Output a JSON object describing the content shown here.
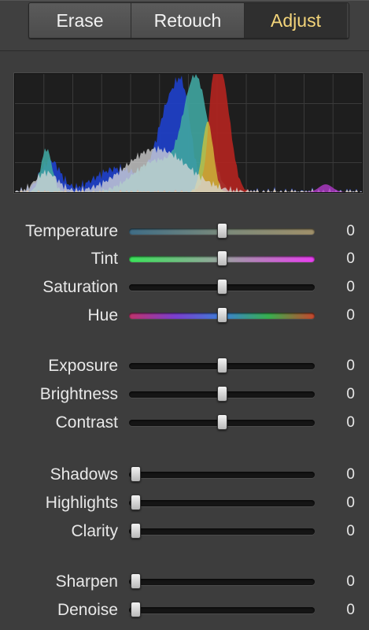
{
  "tabs": [
    {
      "label": "Erase",
      "active": false
    },
    {
      "label": "Retouch",
      "active": false
    },
    {
      "label": "Adjust",
      "active": true
    }
  ],
  "colors": {
    "active_tab_text": "#f4d57a",
    "background": "#3d3d3d",
    "histogram_bg": "#1e1e1e"
  },
  "sliders": [
    {
      "id": "temperature",
      "label": "Temperature",
      "value": "0",
      "position": 0.5,
      "track": "temperature"
    },
    {
      "id": "tint",
      "label": "Tint",
      "value": "0",
      "position": 0.5,
      "track": "tint"
    },
    {
      "id": "saturation",
      "label": "Saturation",
      "value": "0",
      "position": 0.5,
      "track": "plain"
    },
    {
      "id": "hue",
      "label": "Hue",
      "value": "0",
      "position": 0.5,
      "track": "hue"
    },
    {
      "id": "exposure",
      "label": "Exposure",
      "value": "0",
      "position": 0.5,
      "track": "plain"
    },
    {
      "id": "brightness",
      "label": "Brightness",
      "value": "0",
      "position": 0.5,
      "track": "plain"
    },
    {
      "id": "contrast",
      "label": "Contrast",
      "value": "0",
      "position": 0.5,
      "track": "plain"
    },
    {
      "id": "shadows",
      "label": "Shadows",
      "value": "0",
      "position": 0.0,
      "track": "plain"
    },
    {
      "id": "highlights",
      "label": "Highlights",
      "value": "0",
      "position": 0.0,
      "track": "plain"
    },
    {
      "id": "clarity",
      "label": "Clarity",
      "value": "0",
      "position": 0.0,
      "track": "plain"
    },
    {
      "id": "sharpen",
      "label": "Sharpen",
      "value": "0",
      "position": 0.0,
      "track": "plain"
    },
    {
      "id": "denoise",
      "label": "Denoise",
      "value": "0",
      "position": 0.0,
      "track": "plain"
    }
  ]
}
